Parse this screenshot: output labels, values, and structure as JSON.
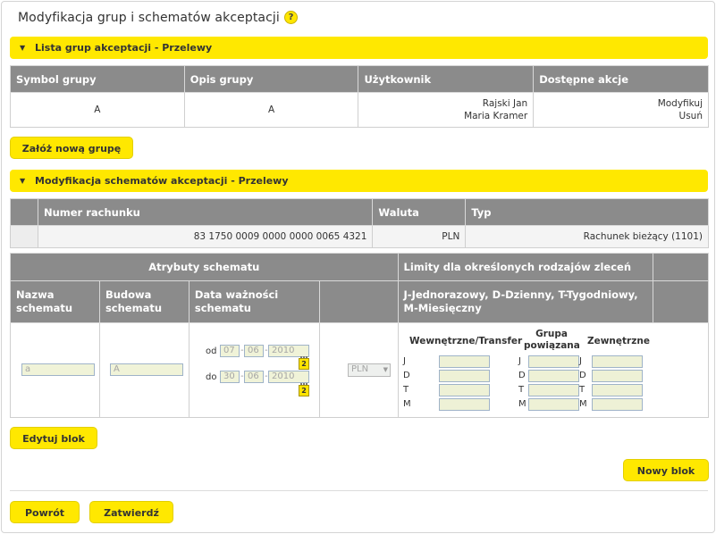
{
  "page": {
    "title": "Modyfikacja grup i schematów akceptacji",
    "help": "?"
  },
  "groups_section": {
    "title": "Lista grup akceptacji - Przelewy",
    "columns": [
      "Symbol grupy",
      "Opis grupy",
      "Użytkownik",
      "Dostępne akcje"
    ],
    "row": {
      "symbol": "A",
      "description": "A",
      "users": [
        "Rajski Jan",
        "Maria Kramer"
      ],
      "actions": [
        "Modyfikuj",
        "Usuń"
      ]
    },
    "new_group_button": "Załóż nową grupę"
  },
  "schemes_section": {
    "title": "Modyfikacja schematów akceptacji - Przelewy",
    "account_columns": [
      "Numer rachunku",
      "Waluta",
      "Typ"
    ],
    "account_row": {
      "number": "83 1750 0009 0000 0000 0065 4321",
      "currency": "PLN",
      "type": "Rachunek bieżący (1101)"
    },
    "attributes_header": "Atrybuty schematu",
    "limits_header": "Limity dla określonych rodzajów zleceń",
    "col_name": "Nazwa schematu",
    "col_structure": "Budowa schematu",
    "col_validity": "Data ważności schematu",
    "col_limits_legend": "J-Jednorazowy, D-Dzienny, T-Tygodniowy, M-Miesięczny",
    "scheme_name_value": "a",
    "scheme_structure_value": "A",
    "from_label": "od",
    "to_label": "do",
    "date_from": {
      "day": "07",
      "month": "06",
      "year": "2010"
    },
    "date_to": {
      "day": "30",
      "month": "06",
      "year": "2010"
    },
    "date_sep": "-",
    "calendar_badge": "2",
    "currency_select": "PLN",
    "limit_groups": [
      "Wewnętrzne/Transfer",
      "Grupa powiązana",
      "Zewnętrzne"
    ],
    "limit_rows": [
      "J",
      "D",
      "T",
      "M"
    ],
    "edit_block_button": "Edytuj blok",
    "new_block_button": "Nowy blok"
  },
  "footer": {
    "back_button": "Powrót",
    "confirm_button": "Zatwierdź"
  },
  "colors": {
    "accent": "#ffe800",
    "header_gray": "#8b8b8b"
  }
}
